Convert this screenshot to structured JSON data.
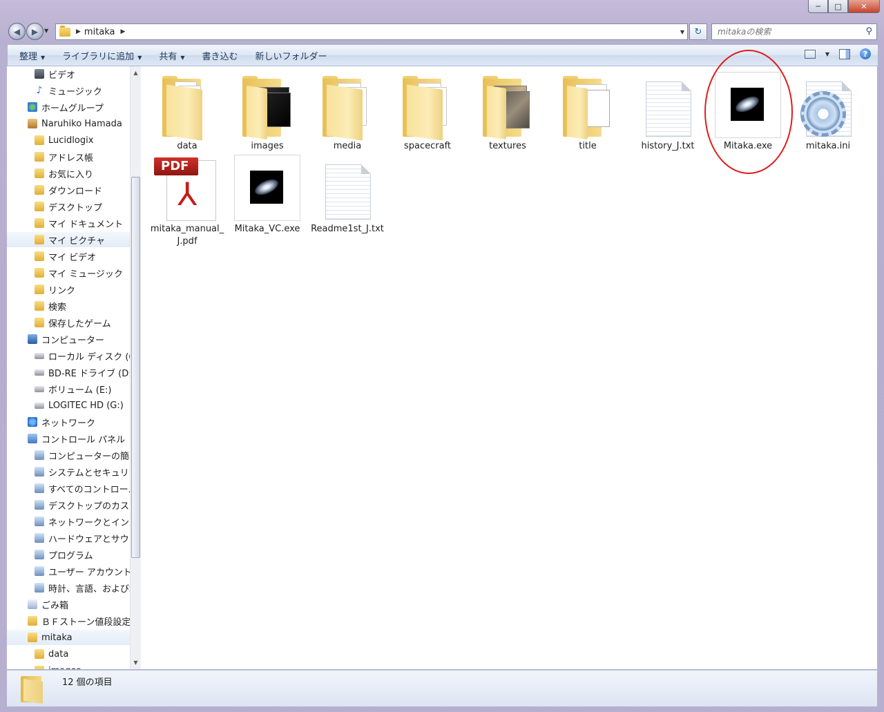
{
  "window": {
    "caption": {
      "minimize": "─",
      "maximize": "□",
      "close": "✕"
    }
  },
  "address": {
    "path": "mitaka",
    "search_placeholder": "mitakaの検索"
  },
  "toolbar": {
    "items": [
      "整理",
      "ライブラリに追加",
      "共有",
      "書き込む",
      "新しいフォルダー"
    ]
  },
  "nav": {
    "items": [
      {
        "label": "ビデオ",
        "icon": "video-icon"
      },
      {
        "label": "ミュージック",
        "icon": "music-icon"
      },
      {
        "label": "ホームグループ",
        "icon": "homegroup-icon"
      },
      {
        "label": "Naruhiko Hamada",
        "icon": "user-folder-icon"
      },
      {
        "label": "Lucidlogix",
        "icon": "folder-icon"
      },
      {
        "label": "アドレス帳",
        "icon": "folder-icon"
      },
      {
        "label": "お気に入り",
        "icon": "folder-icon"
      },
      {
        "label": "ダウンロード",
        "icon": "folder-icon"
      },
      {
        "label": "デスクトップ",
        "icon": "folder-icon"
      },
      {
        "label": "マイ ドキュメント",
        "icon": "folder-icon"
      },
      {
        "label": "マイ ピクチャ",
        "icon": "folder-icon"
      },
      {
        "label": "マイ ビデオ",
        "icon": "folder-icon"
      },
      {
        "label": "マイ ミュージック",
        "icon": "folder-icon"
      },
      {
        "label": "リンク",
        "icon": "folder-icon"
      },
      {
        "label": "検索",
        "icon": "folder-icon"
      },
      {
        "label": "保存したゲーム",
        "icon": "folder-icon"
      },
      {
        "label": "コンピューター",
        "icon": "computer-icon"
      },
      {
        "label": "ローカル ディスク (C",
        "icon": "drive-icon"
      },
      {
        "label": "BD-RE ドライブ (D:)",
        "icon": "drive-icon"
      },
      {
        "label": "ボリューム (E:)",
        "icon": "drive-icon"
      },
      {
        "label": "LOGITEC HD (G:)",
        "icon": "drive-icon"
      },
      {
        "label": "ネットワーク",
        "icon": "network-icon"
      },
      {
        "label": "コントロール パネル",
        "icon": "control-panel-icon"
      },
      {
        "label": "コンピューターの簡単",
        "icon": "control-panel-item-icon"
      },
      {
        "label": "システムとセキュリテ",
        "icon": "control-panel-item-icon"
      },
      {
        "label": "すべてのコントロール",
        "icon": "control-panel-item-icon"
      },
      {
        "label": "デスクトップのカスタ",
        "icon": "control-panel-item-icon"
      },
      {
        "label": "ネットワークとインタ",
        "icon": "control-panel-item-icon"
      },
      {
        "label": "ハードウェアとサウン",
        "icon": "control-panel-item-icon"
      },
      {
        "label": "プログラム",
        "icon": "control-panel-item-icon"
      },
      {
        "label": "ユーザー アカウント",
        "icon": "control-panel-item-icon"
      },
      {
        "label": "時計、言語、および地",
        "icon": "control-panel-item-icon"
      },
      {
        "label": "ごみ箱",
        "icon": "recycle-bin-icon"
      },
      {
        "label": "ＢＦストーン値段設定",
        "icon": "folder-icon"
      },
      {
        "label": "mitaka",
        "icon": "folder-icon"
      },
      {
        "label": "data",
        "icon": "folder-icon"
      },
      {
        "label": "images",
        "icon": "folder-icon"
      }
    ],
    "selected": [
      "マイ ピクチャ",
      "mitaka"
    ]
  },
  "files": [
    {
      "name": "data",
      "type": "folder"
    },
    {
      "name": "images",
      "type": "folder"
    },
    {
      "name": "media",
      "type": "folder"
    },
    {
      "name": "spacecraft",
      "type": "folder"
    },
    {
      "name": "textures",
      "type": "folder"
    },
    {
      "name": "title",
      "type": "folder"
    },
    {
      "name": "history_J.txt",
      "type": "text"
    },
    {
      "name": "Mitaka.exe",
      "type": "exe",
      "highlighted": true
    },
    {
      "name": "mitaka.ini",
      "type": "settings"
    },
    {
      "name": "mitaka_manual_J.pdf",
      "type": "pdf"
    },
    {
      "name": "Mitaka_VC.exe",
      "type": "exe"
    },
    {
      "name": "Readme1st_J.txt",
      "type": "text"
    }
  ],
  "status": {
    "count_text": "12 個の項目"
  },
  "colors": {
    "highlight_circle": "#e01b1b",
    "toolbar_text": "#1e395b"
  }
}
